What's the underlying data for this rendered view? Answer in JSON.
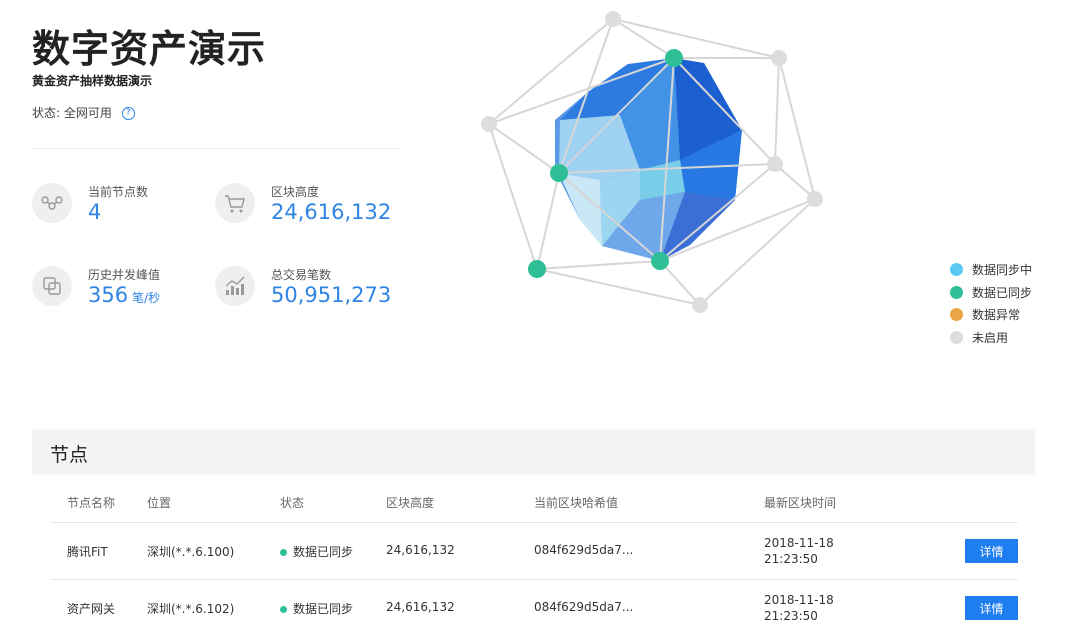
{
  "header": {
    "title": "数字资产演示",
    "subtitle": "黄金资产抽样数据演示",
    "status_label": "状态:",
    "status_value": "全网可用"
  },
  "stats": [
    {
      "label": "当前节点数",
      "value": "4",
      "unit": "",
      "icon": "nodes-icon"
    },
    {
      "label": "区块高度",
      "value": "24,616,132",
      "unit": "",
      "icon": "cart-icon"
    },
    {
      "label": "历史并发峰值",
      "value": "356",
      "unit": "笔/秒",
      "icon": "copy-icon"
    },
    {
      "label": "总交易笔数",
      "value": "50,951,273",
      "unit": "",
      "icon": "trend-chart-icon"
    }
  ],
  "legend": [
    {
      "label": "数据同步中",
      "color": "#5bc8f2"
    },
    {
      "label": "数据已同步",
      "color": "#2ebf97"
    },
    {
      "label": "数据异常",
      "color": "#eba445"
    },
    {
      "label": "未启用",
      "color": "#dddddd"
    }
  ],
  "colors": {
    "accent": "#2f84e4",
    "button": "#1e7ef0",
    "synced": "#2ebf97"
  },
  "nodes_panel": {
    "title": "节点",
    "columns": [
      "节点名称",
      "位置",
      "状态",
      "区块高度",
      "当前区块哈希值",
      "最新区块时间"
    ],
    "rows": [
      {
        "name": "腾讯FiT",
        "location": "深圳(*.*.6.100)",
        "status": "数据已同步",
        "height": "24,616,132",
        "hash": "084f629d5da7...",
        "date": "2018-11-18",
        "time": "21:23:50",
        "action": "详情"
      },
      {
        "name": "资产网关",
        "location": "深圳(*.*.6.102)",
        "status": "数据已同步",
        "height": "24,616,132",
        "hash": "084f629d5da7...",
        "date": "2018-11-18",
        "time": "21:23:50",
        "action": "详情"
      }
    ]
  }
}
